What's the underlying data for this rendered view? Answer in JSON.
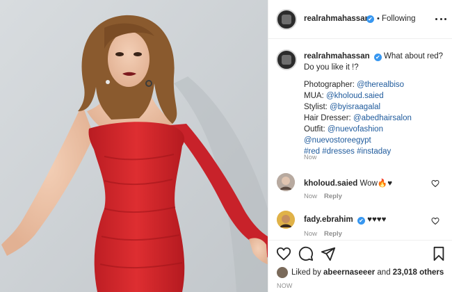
{
  "post": {
    "image_alt_icon": "photo-of-woman-in-red-dress",
    "colors": {
      "dress": "#d4262a",
      "wall": "#cfd3d6",
      "hair": "#8a5a2e"
    }
  },
  "header": {
    "username": "realrahmahassan",
    "verified_glyph": "✔",
    "separator": "•",
    "follow_status": "Following"
  },
  "caption": {
    "username": "realrahmahassan",
    "verified_glyph": "✔",
    "text": "What about red? Do you like it !?",
    "credits": [
      {
        "label": "Photographer: ",
        "value": "@therealbiso"
      },
      {
        "label": "MUA: ",
        "value": "@kholoud.saied"
      },
      {
        "label": "Stylist: ",
        "value": "@byisraagalal"
      },
      {
        "label": "Hair Dresser: ",
        "value": "@abedhairsalon"
      },
      {
        "label": "Outfit: ",
        "value": "@nuevofashion"
      },
      {
        "label": "",
        "value": "@nuevostoreegypt"
      },
      {
        "label": "",
        "value": "#red #dresses #instaday"
      }
    ],
    "timestamp": "Now"
  },
  "comments": [
    {
      "username": "kholoud.saied",
      "verified": false,
      "text": "Wow🔥♥",
      "time": "Now",
      "reply": "Reply"
    },
    {
      "username": "fady.ebrahim",
      "verified": true,
      "verified_glyph": "✔",
      "text": "♥♥♥♥",
      "time": "Now",
      "reply": "Reply"
    }
  ],
  "likes": {
    "prefix": "Liked by ",
    "user": "abeernaseeer",
    "middle": " and ",
    "others": "23,018 others"
  },
  "post_timestamp": "NOW",
  "icons": [
    "more-options-icon",
    "heart-icon",
    "comment-icon",
    "share-icon",
    "bookmark-icon"
  ]
}
